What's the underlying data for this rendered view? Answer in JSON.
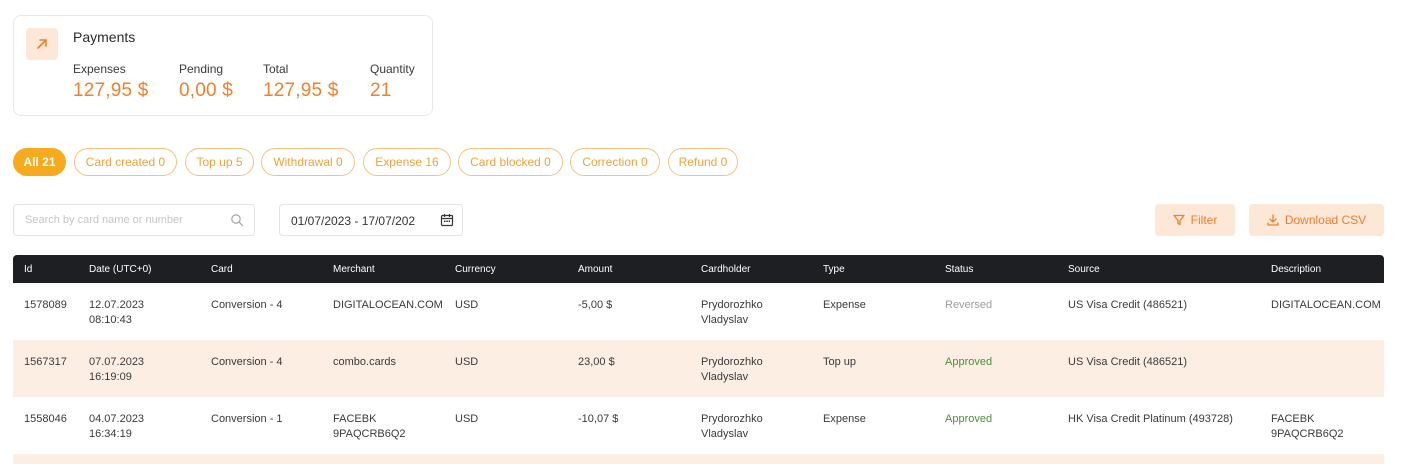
{
  "summary": {
    "title": "Payments",
    "metrics": [
      {
        "label": "Expenses",
        "value": "127,95 $"
      },
      {
        "label": "Pending",
        "value": "0,00 $"
      },
      {
        "label": "Total",
        "value": "127,95 $"
      },
      {
        "label": "Quantity",
        "value": "21"
      }
    ]
  },
  "chips": [
    {
      "label": "All 21",
      "active": true
    },
    {
      "label": "Card created 0"
    },
    {
      "label": "Top up 5"
    },
    {
      "label": "Withdrawal 0"
    },
    {
      "label": "Expense 16"
    },
    {
      "label": "Card blocked 0"
    },
    {
      "label": "Correction 0"
    },
    {
      "label": "Refund 0"
    }
  ],
  "search": {
    "placeholder": "Search by card name or number",
    "value": ""
  },
  "date_range": {
    "value": "01/07/2023 - 17/07/202"
  },
  "buttons": {
    "filter": "Filter",
    "download_csv": "Download CSV"
  },
  "table": {
    "headers": [
      "Id",
      "Date (UTC+0)",
      "Card",
      "Merchant",
      "Currency",
      "Amount",
      "Cardholder",
      "Type",
      "Status",
      "Source",
      "Description"
    ],
    "rows": [
      {
        "id": "1578089",
        "date": "12.07.2023",
        "time": "08:10:43",
        "card": "Conversion - 4",
        "merchant": [
          "DIGITALOCEAN.COM"
        ],
        "currency": "USD",
        "amount": "-5,00 $",
        "cardholder": [
          "Prydorozhko",
          "Vladyslav"
        ],
        "type": "Expense",
        "status": "Reversed",
        "source": "US Visa Credit (486521)",
        "description": [
          "DIGITALOCEAN.COM"
        ]
      },
      {
        "id": "1567317",
        "date": "07.07.2023",
        "time": "16:19:09",
        "card": "Conversion - 4",
        "merchant": [
          "combo.cards"
        ],
        "currency": "USD",
        "amount": "23,00 $",
        "cardholder": [
          "Prydorozhko",
          "Vladyslav"
        ],
        "type": "Top up",
        "status": "Approved",
        "source": "US Visa Credit (486521)",
        "description": []
      },
      {
        "id": "1558046",
        "date": "04.07.2023",
        "time": "16:34:19",
        "card": "Conversion - 1",
        "merchant": [
          "FACEBK",
          "9PAQCRB6Q2"
        ],
        "currency": "USD",
        "amount": "-10,07 $",
        "cardholder": [
          "Prydorozhko",
          "Vladyslav"
        ],
        "type": "Expense",
        "status": "Approved",
        "source": "HK Visa Credit Platinum (493728)",
        "description": [
          "FACEBK",
          "9PAQCRB6Q2"
        ]
      }
    ]
  },
  "colors": {
    "accent": "#f07f2e",
    "chip_active": "#f6ab1f",
    "header_bg": "#1e1f22",
    "row_alt": "#fdeee3",
    "approved": "#4b8f3a",
    "reversed": "#9b9b9b"
  },
  "icons": {
    "summary": "arrow-up-right-icon",
    "search": "search-icon",
    "calendar": "calendar-icon",
    "filter": "filter-icon",
    "download": "download-icon"
  }
}
